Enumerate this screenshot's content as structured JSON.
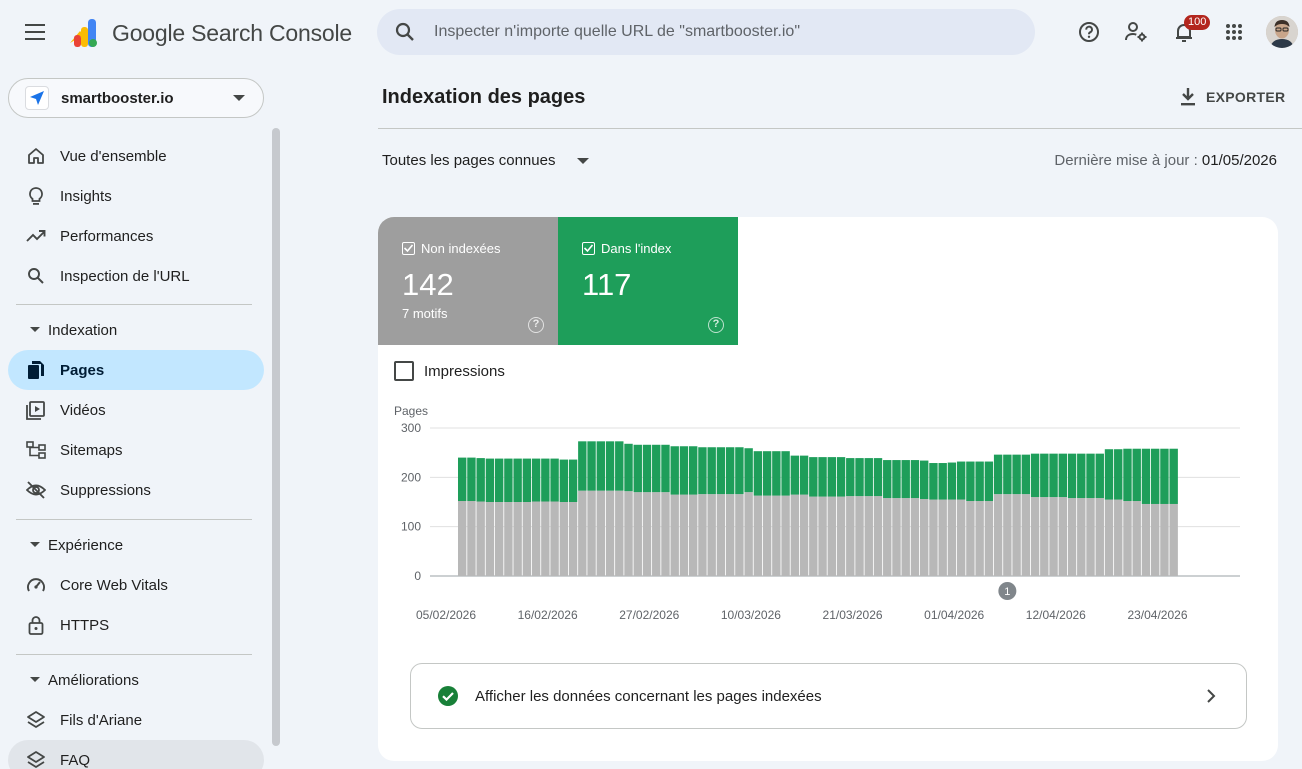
{
  "app": {
    "brand": "Google Search Console",
    "search_placeholder": "Inspecter n'importe quelle URL de \"smartbooster.io\"",
    "notifications_count": "100"
  },
  "property": {
    "name": "smartbooster.io"
  },
  "sidebar": {
    "top_items": [
      {
        "label": "Vue d'ensemble",
        "icon": "home-icon"
      },
      {
        "label": "Insights",
        "icon": "lightbulb-icon"
      },
      {
        "label": "Performances",
        "icon": "trending-up-icon"
      },
      {
        "label": "Inspection de l'URL",
        "icon": "search-icon"
      }
    ],
    "sections": [
      {
        "title": "Indexation",
        "items": [
          {
            "label": "Pages",
            "icon": "pages-icon",
            "active": true
          },
          {
            "label": "Vidéos",
            "icon": "video-icon"
          },
          {
            "label": "Sitemaps",
            "icon": "sitemap-icon"
          },
          {
            "label": "Suppressions",
            "icon": "eye-off-icon"
          }
        ]
      },
      {
        "title": "Expérience",
        "items": [
          {
            "label": "Core Web Vitals",
            "icon": "gauge-icon"
          },
          {
            "label": "HTTPS",
            "icon": "lock-icon"
          }
        ]
      },
      {
        "title": "Améliorations",
        "items": [
          {
            "label": "Fils d'Ariane",
            "icon": "layers-icon"
          },
          {
            "label": "FAQ",
            "icon": "layers-icon"
          }
        ]
      }
    ]
  },
  "main": {
    "title": "Indexation des pages",
    "export_label": "EXPORTER",
    "filter_label": "Toutes les pages connues",
    "updated_prefix": "Dernière mise à jour : ",
    "updated_date": "01/05/2026",
    "tiles": [
      {
        "label": "Non indexées",
        "value": "142",
        "sub": "7 motifs",
        "color": "#9e9e9e"
      },
      {
        "label": "Dans l'index",
        "value": "117",
        "sub": "",
        "color": "#1e9e5a"
      }
    ],
    "impressions_label": "Impressions",
    "link_label": "Afficher les données concernant les pages indexées"
  },
  "chart_data": {
    "type": "bar",
    "stacked": true,
    "ylabel": "Pages",
    "ylim": [
      0,
      300
    ],
    "yticks": [
      0,
      100,
      200,
      300
    ],
    "xtick_labels": [
      "05/02/2026",
      "16/02/2026",
      "27/02/2026",
      "10/03/2026",
      "21/03/2026",
      "01/04/2026",
      "12/04/2026",
      "23/04/2026"
    ],
    "first_date": "05/02/2026",
    "annotation": {
      "label": "1",
      "date": "05/04/2026"
    },
    "series": [
      {
        "name": "Non indexées",
        "color": "#b8b8b8",
        "values": [
          152,
          152,
          151,
          150,
          150,
          150,
          150,
          150,
          151,
          151,
          151,
          150,
          150,
          173,
          173,
          173,
          173,
          173,
          172,
          170,
          170,
          170,
          170,
          165,
          165,
          165,
          166,
          166,
          166,
          166,
          166,
          170,
          163,
          163,
          163,
          163,
          165,
          165,
          161,
          161,
          161,
          161,
          162,
          162,
          162,
          162,
          158,
          158,
          158,
          158,
          156,
          155,
          155,
          155,
          155,
          152,
          152,
          152,
          166,
          166,
          166,
          166,
          160,
          160,
          160,
          160,
          158,
          158,
          158,
          158,
          155,
          155,
          152,
          152,
          146,
          146,
          146,
          146
        ]
      },
      {
        "name": "Dans l'index",
        "color": "#1e9e5a",
        "values": [
          88,
          88,
          88,
          88,
          88,
          88,
          88,
          88,
          87,
          87,
          87,
          86,
          86,
          100,
          100,
          100,
          100,
          100,
          96,
          96,
          96,
          96,
          96,
          98,
          98,
          98,
          95,
          95,
          95,
          95,
          95,
          89,
          90,
          90,
          90,
          90,
          79,
          79,
          80,
          80,
          80,
          80,
          77,
          77,
          77,
          77,
          77,
          77,
          77,
          77,
          78,
          74,
          74,
          75,
          77,
          80,
          80,
          80,
          80,
          80,
          80,
          80,
          88,
          88,
          88,
          88,
          90,
          90,
          90,
          90,
          102,
          102,
          106,
          106,
          112,
          112,
          112,
          112
        ]
      }
    ]
  }
}
